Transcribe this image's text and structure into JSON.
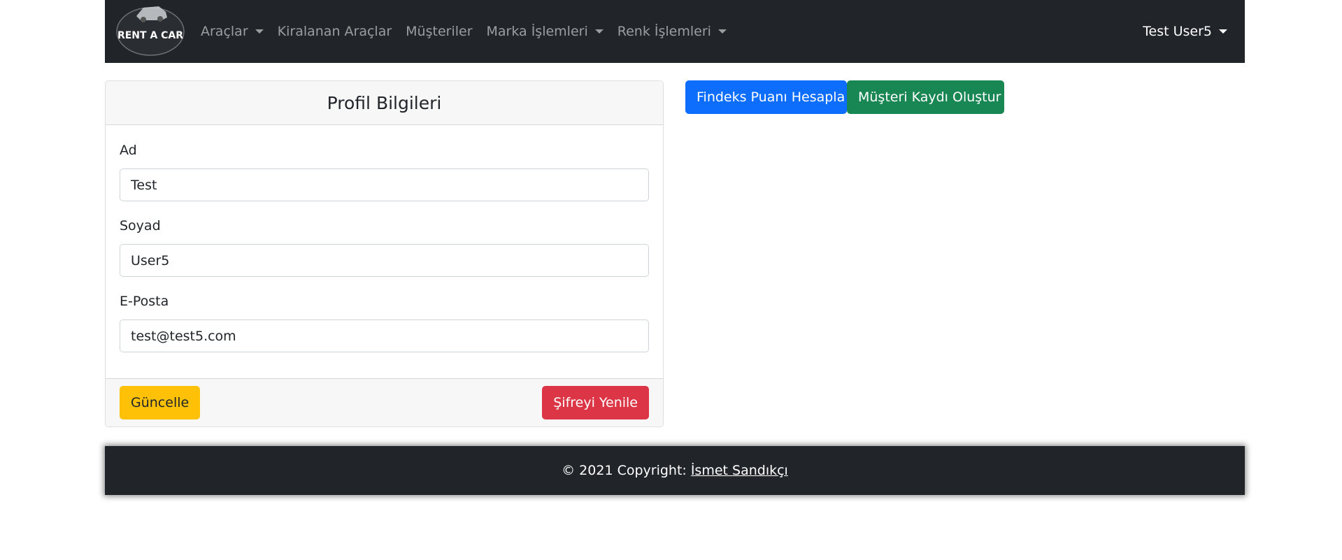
{
  "navbar": {
    "brand_text": "RENT A CAR",
    "items": [
      {
        "label": "Araçlar",
        "dropdown": true
      },
      {
        "label": "Kiralanan Araçlar",
        "dropdown": false
      },
      {
        "label": "Müşteriler",
        "dropdown": false
      },
      {
        "label": "Marka İşlemleri",
        "dropdown": true
      },
      {
        "label": "Renk İşlemleri",
        "dropdown": true
      }
    ],
    "user": "Test User5"
  },
  "profile_card": {
    "title": "Profil Bilgileri",
    "fields": [
      {
        "label": "Ad",
        "value": "Test"
      },
      {
        "label": "Soyad",
        "value": "User5"
      },
      {
        "label": "E-Posta",
        "value": "test@test5.com"
      }
    ],
    "update_button": "Güncelle",
    "reset_password_button": "Şifreyi Yenile"
  },
  "actions": {
    "findeks_button": "Findeks Puanı Hesapla",
    "customer_button": "Müşteri Kaydı Oluştur"
  },
  "footer": {
    "copyright": "© 2021 Copyright:",
    "author": "İsmet Sandıkçı"
  },
  "colors": {
    "navbar_bg": "#212529",
    "primary": "#0d6efd",
    "success": "#198754",
    "warning": "#ffc107",
    "danger": "#dc3545"
  }
}
